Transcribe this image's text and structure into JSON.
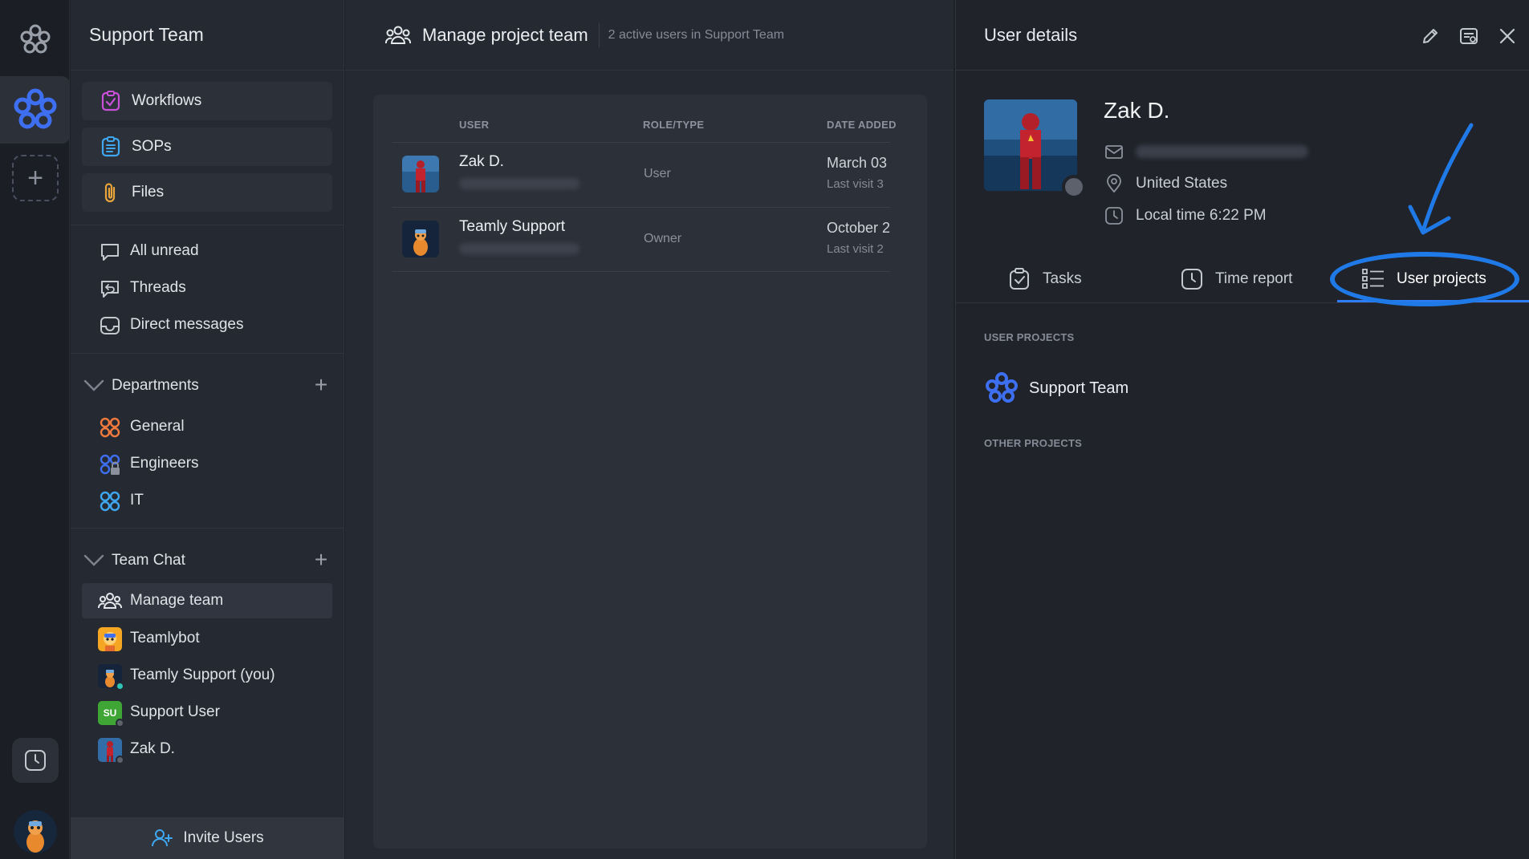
{
  "rail": {
    "add_symbol": "+"
  },
  "sidebar": {
    "title": "Support Team",
    "cards": [
      {
        "label": "Workflows",
        "icon": "workflows-icon"
      },
      {
        "label": "SOPs",
        "icon": "sops-icon"
      },
      {
        "label": "Files",
        "icon": "paperclip-icon"
      }
    ],
    "inbox": [
      {
        "label": "All unread",
        "icon": "chat-bubble-icon"
      },
      {
        "label": "Threads",
        "icon": "threads-icon"
      },
      {
        "label": "Direct messages",
        "icon": "inbox-icon"
      }
    ],
    "departments": {
      "title": "Departments",
      "add": "+",
      "items": [
        {
          "label": "General",
          "color": "#f0793e"
        },
        {
          "label": "Engineers",
          "color": "#3d6ff0"
        },
        {
          "label": "IT",
          "color": "#3ea7f0"
        }
      ]
    },
    "team_chat": {
      "title": "Team Chat",
      "add": "+",
      "items": [
        {
          "label": "Manage team",
          "icon": "team-icon"
        },
        {
          "label": "Teamlybot",
          "icon": "bot-avatar"
        },
        {
          "label": "Teamly Support (you)",
          "icon": "support-avatar"
        },
        {
          "label": "Support User",
          "initials": "SU",
          "color": "#3fa535"
        },
        {
          "label": "Zak D.",
          "icon": "user-avatar"
        }
      ]
    },
    "invite_label": "Invite Users"
  },
  "main": {
    "title": "Manage project team",
    "subtitle": "2 active users in Support Team",
    "columns": [
      "USER",
      "ROLE/TYPE",
      "DATE ADDED"
    ],
    "rows": [
      {
        "name": "Zak D.",
        "role": "User",
        "date": "March 03",
        "visit": "Last visit 3"
      },
      {
        "name": "Teamly Support",
        "role": "Owner",
        "date": "October 2",
        "visit": "Last visit 2"
      }
    ]
  },
  "details": {
    "title": "User details",
    "name": "Zak D.",
    "location": "United States",
    "local_time": "Local time 6:22 PM",
    "tabs": [
      {
        "label": "Tasks",
        "icon": "clipboard-check-icon"
      },
      {
        "label": "Time report",
        "icon": "clock-icon"
      },
      {
        "label": "User projects",
        "icon": "list-icon",
        "active": true
      }
    ],
    "user_projects_label": "USER PROJECTS",
    "project_name": "Support Team",
    "other_projects_label": "OTHER PROJECTS"
  },
  "colors": {
    "accent": "#2f7df6",
    "brand": "#3d6ff0",
    "annotation": "#1f7ae8"
  }
}
